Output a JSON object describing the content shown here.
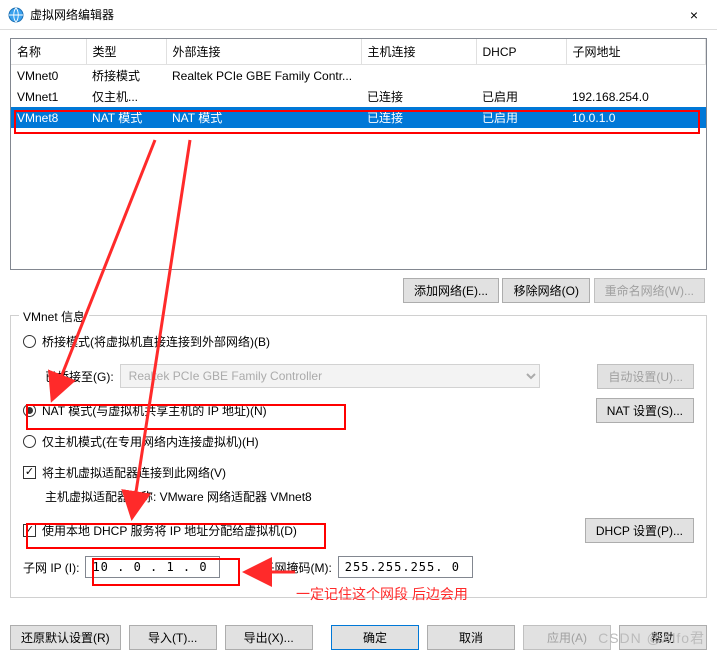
{
  "window": {
    "title": "虚拟网络编辑器",
    "close": "×"
  },
  "table": {
    "cols": {
      "name": "名称",
      "type": "类型",
      "ext": "外部连接",
      "host": "主机连接",
      "dhcp": "DHCP",
      "subnet": "子网地址"
    },
    "rows": [
      {
        "name": "VMnet0",
        "type": "桥接模式",
        "ext": "Realtek PCIe GBE Family Contr...",
        "host": "",
        "dhcp": "",
        "subnet": ""
      },
      {
        "name": "VMnet1",
        "type": "仅主机...",
        "ext": "",
        "host": "已连接",
        "dhcp": "已启用",
        "subnet": "192.168.254.0"
      },
      {
        "name": "VMnet8",
        "type": "NAT 模式",
        "ext": "NAT 模式",
        "host": "已连接",
        "dhcp": "已启用",
        "subnet": "10.0.1.0"
      }
    ]
  },
  "buttons": {
    "add": "添加网络(E)...",
    "remove": "移除网络(O)",
    "rename": "重命名网络(W)...",
    "autoset": "自动设置(U)...",
    "natset": "NAT 设置(S)...",
    "dhcpset": "DHCP 设置(P)...",
    "restore": "还原默认设置(R)",
    "import": "导入(T)...",
    "export": "导出(X)...",
    "ok": "确定",
    "cancel": "取消",
    "apply": "应用(A)",
    "help": "帮助"
  },
  "info": {
    "legend": "VMnet 信息",
    "bridged_label": "桥接模式(将虚拟机直接连接到外部网络)(B)",
    "bridged_to": "已桥接至(G):",
    "bridged_adapter": "Realtek PCIe GBE Family Controller",
    "nat_label": "NAT 模式(与虚拟机共享主机的 IP 地址)(N)",
    "hostonly_label": "仅主机模式(在专用网络内连接虚拟机)(H)",
    "connect_host_label": "将主机虚拟适配器连接到此网络(V)",
    "adapter_name": "主机虚拟适配器名称: VMware 网络适配器 VMnet8",
    "use_dhcp_label": "使用本地 DHCP 服务将 IP 地址分配给虚拟机(D)",
    "subnet_ip_label": "子网 IP (I):",
    "subnet_ip": "10 . 0 . 1 . 0",
    "subnet_mask_label": "子网掩码(M):",
    "subnet_mask": "255.255.255. 0"
  },
  "annot": {
    "note": "一定记住这个网段 后边会用"
  },
  "watermark": "CSDN @Alfo君"
}
